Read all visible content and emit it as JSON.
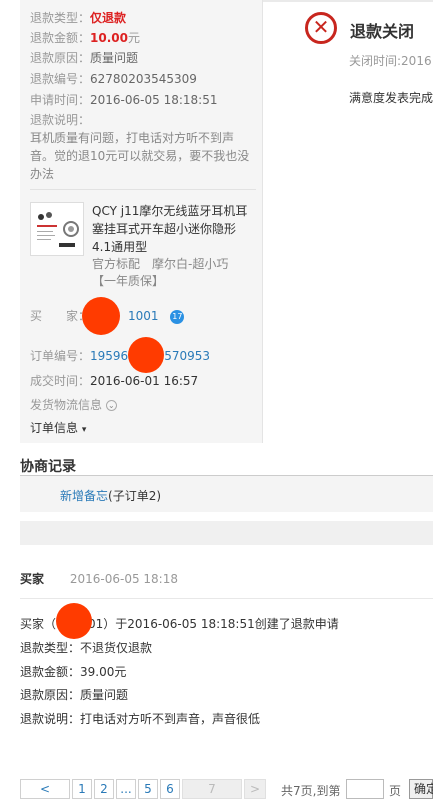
{
  "refund_info": {
    "type_label": "退款类型：",
    "type_value": "仅退款",
    "amount_label": "退款金额：",
    "amount_value": "10.00",
    "amount_unit": "元",
    "reason_label": "退款原因：",
    "reason_value": "质量问题",
    "number_label": "退款编号：",
    "number_value": "62780203545309",
    "apply_time_label": "申请时间：",
    "apply_time_value": "2016-06-05 18:18:51",
    "desc_label": "退款说明：",
    "desc_value": "耳机质量有问题，打电话对方听不到声音。觉的退10元可以就交易，要不我也没办法"
  },
  "product": {
    "title": "QCY j11摩尔无线蓝牙耳机耳塞挂耳式开车超小迷你隐形4.1通用型",
    "spec": "官方标配　摩尔白-超小巧【一年质保】"
  },
  "order": {
    "buyer_label": "买　　家：",
    "buyer_suffix": "1001",
    "order_no_label": "订单编号：",
    "order_no_prefix": "19596",
    "order_no_suffix": "570953",
    "deal_time_label": "成交时间：",
    "deal_time_value": "2016-06-01 16:57",
    "logistics_label": "发货物流信息",
    "order_info_label": "订单信息"
  },
  "status": {
    "title": "退款关闭",
    "close_time_label": "关闭时间:2016",
    "satisfaction": "满意度发表完成"
  },
  "negotiation": {
    "title": "协商记录",
    "note_link": "新增备忘",
    "note_suffix": "(子订单2)",
    "record": {
      "author": "买家",
      "time": "2016-06-05 18:18",
      "line1_prefix": "买家（",
      "line1_mid": "01）于2016-06-05 18:18:51创建了退款申请",
      "line2": "退款类型：不退货仅退款",
      "line3": "退款金额：39.00元",
      "line4": "退款原因：质量问题",
      "line5": "退款说明：打电话对方听不到声音，声音很低"
    }
  },
  "pagination": {
    "prev": "<",
    "pages": [
      "1",
      "2",
      "...",
      "5",
      "6",
      "7"
    ],
    "next": ">",
    "total_text": "共7页,到第",
    "page_unit": "页",
    "confirm": "确定"
  },
  "colors": {
    "accent_red": "#d22222",
    "link_blue": "#2a7ab8",
    "redaction": "#ff3b00"
  }
}
